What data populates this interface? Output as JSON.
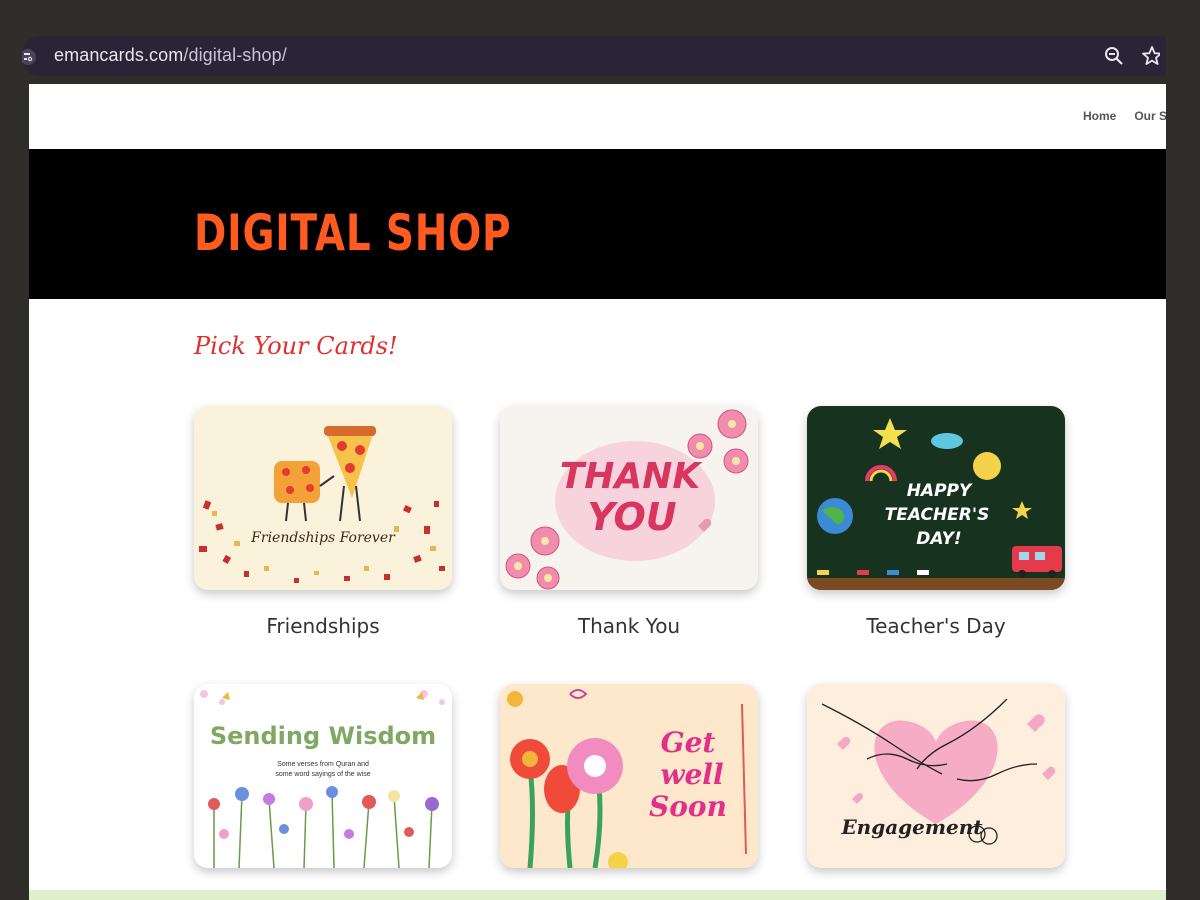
{
  "browser": {
    "url_host": "emancards.com",
    "url_path": "/digital-shop/"
  },
  "nav": {
    "items": [
      "Home",
      "Our S"
    ]
  },
  "hero": {
    "title": "DIGITAL SHOP"
  },
  "section": {
    "heading": "Pick Your Cards!"
  },
  "cards": [
    {
      "label": "Friendships",
      "art_text": "Friendships Forever"
    },
    {
      "label": "Thank You",
      "art_text": [
        "THANK",
        "YOU"
      ]
    },
    {
      "label": "Teacher's Day",
      "art_text": [
        "HAPPY",
        "TEACHER'S",
        "DAY!"
      ]
    },
    {
      "label": "",
      "art_text": "Sending Wisdom",
      "art_subtext": [
        "Some verses from Quran and",
        "some word sayings of the wise"
      ]
    },
    {
      "label": "",
      "art_text": [
        "Get",
        "well",
        "Soon"
      ]
    },
    {
      "label": "",
      "art_text": "Engagement"
    }
  ],
  "colors": {
    "hero_title": "#ff5a1f",
    "section_heading": "#e02f2f",
    "hero_bg": "#000000"
  }
}
